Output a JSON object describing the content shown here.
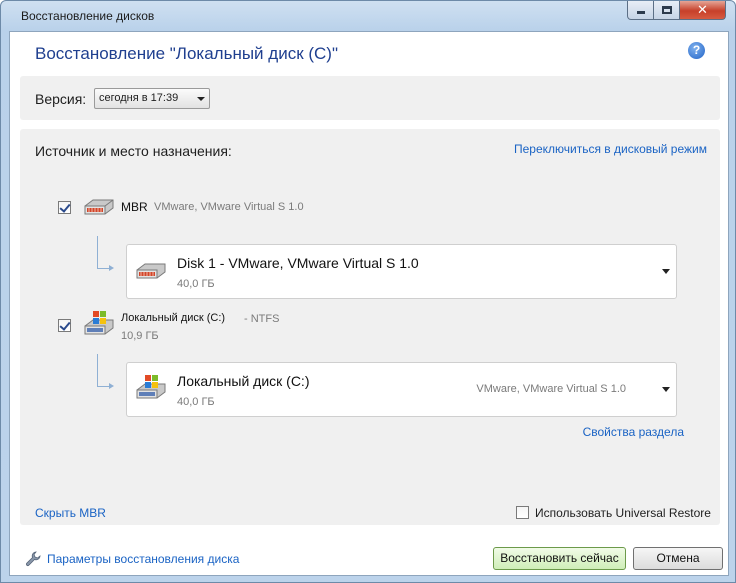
{
  "window": {
    "title": "Восстановление дисков"
  },
  "header": {
    "title": "Восстановление \"Локальный диск (С)\""
  },
  "version": {
    "label": "Версия:",
    "selected": "сегодня в 17:39"
  },
  "section": {
    "title": "Источник и место назначения:",
    "switch_link": "Переключиться в дисковый режим"
  },
  "sources": [
    {
      "name": "MBR",
      "detail": "VMware, VMware Virtual S 1.0",
      "size": "",
      "checked": true,
      "target": {
        "name": "Disk 1 - VMware, VMware Virtual S 1.0",
        "size": "40,0 ГБ",
        "info": ""
      }
    },
    {
      "name": "Локальный диск (C:)",
      "detail": "- NTFS",
      "size": "10,9 ГБ",
      "checked": true,
      "target": {
        "name": "Локальный диск (C:)",
        "size": "40,0 ГБ",
        "info": "VMware, VMware Virtual S 1.0"
      }
    }
  ],
  "partition_props_link": "Свойства раздела",
  "hide_mbr_link": "Скрыть MBR",
  "universal_restore": {
    "label": "Использовать Universal Restore",
    "checked": false
  },
  "footer": {
    "params_link": "Параметры восстановления диска",
    "restore_button": "Восстановить сейчас",
    "cancel_button": "Отмена"
  },
  "colors": {
    "accent": "#1f3f8f",
    "link": "#1a63c4",
    "panel": "#f0f0f0"
  }
}
